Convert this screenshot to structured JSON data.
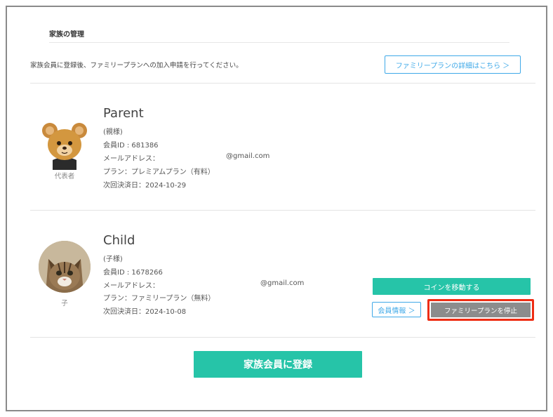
{
  "section": {
    "title": "家族の管理"
  },
  "intro": {
    "text": "家族会員に登録後、ファミリープランへの加入申請を行ってください。",
    "details_link": "ファミリープランの詳細はこちら ＞"
  },
  "members": [
    {
      "name": "Parent",
      "role": "(親様)",
      "member_id": "会員ID : 681386",
      "email_label": "メールアドレス：",
      "email_domain": "@gmail.com",
      "plan": "プラン：プレミアムプラン（有料）",
      "next_billing": "次回決済日：2024-10-29",
      "caption": "代表者",
      "avatar_icon": "bear-avatar-icon"
    },
    {
      "name": "Child",
      "role": "(子様)",
      "member_id": "会員ID : 1678266",
      "email_label": "メールアドレス：",
      "email_domain": "@gmail.com",
      "plan": "プラン：ファミリープラン（無料）",
      "next_billing": "次回決済日：2024-10-08",
      "caption": "子",
      "avatar_icon": "cat-photo-avatar",
      "actions": {
        "move_coins": "コインを移動する",
        "member_info": "会員情報 ＞",
        "stop_plan": "ファミリープランを停止"
      }
    }
  ],
  "register_button": "家族会員に登録",
  "colors": {
    "accent_green": "#26c4a8",
    "link_blue": "#3fa9e8",
    "highlight_red": "#ee2d14",
    "stop_gray": "#8c8c8c"
  }
}
